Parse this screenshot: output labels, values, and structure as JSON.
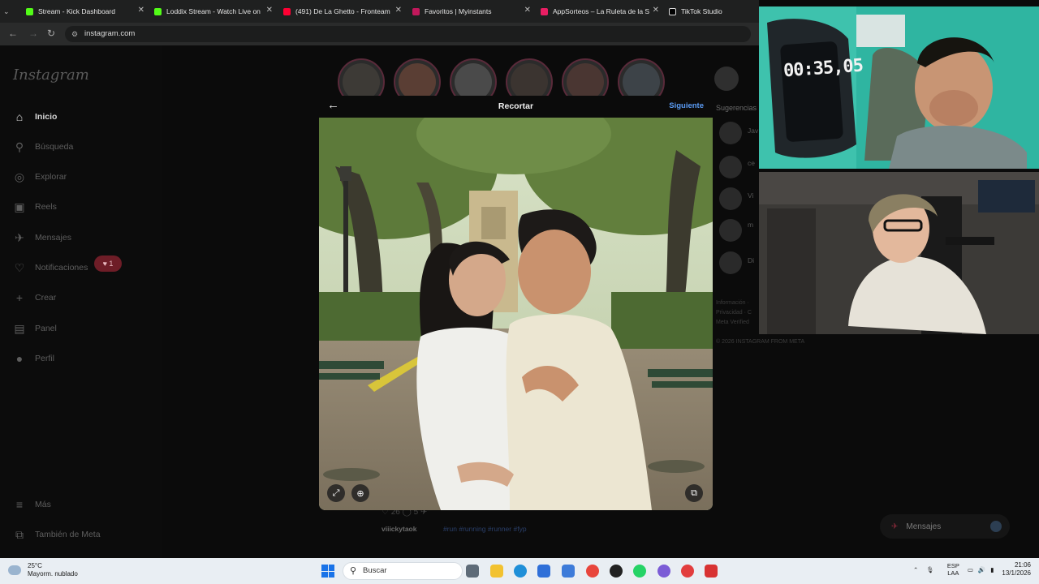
{
  "browser": {
    "tabs": [
      {
        "label": "Stream - Kick Dashboard",
        "color": "#53fc18"
      },
      {
        "label": "Loddix Stream - Watch Live on",
        "color": "#53fc18"
      },
      {
        "label": "(491) De La Ghetto - Fronteam",
        "color": "#ff0033"
      },
      {
        "label": "Favoritos | Myinstants",
        "color": "#c2185b"
      },
      {
        "label": "AppSorteos – La Ruleta de la S",
        "color": "#e91e63"
      },
      {
        "label": "TikTok Studio",
        "color": "#111111"
      }
    ],
    "url": "instagram.com"
  },
  "instagram": {
    "logo": "Instagram",
    "nav": [
      {
        "label": "Inicio",
        "icon": "home-icon",
        "glyph": "⌂",
        "active": true
      },
      {
        "label": "Búsqueda",
        "icon": "search-icon",
        "glyph": "⚲"
      },
      {
        "label": "Explorar",
        "icon": "compass-icon",
        "glyph": "◎"
      },
      {
        "label": "Reels",
        "icon": "reels-icon",
        "glyph": "▣"
      },
      {
        "label": "Mensajes",
        "icon": "messenger-icon",
        "glyph": "✈"
      },
      {
        "label": "Notificaciones",
        "icon": "heart-icon",
        "glyph": "♡"
      },
      {
        "label": "Crear",
        "icon": "plus-icon",
        "glyph": "+"
      },
      {
        "label": "Panel",
        "icon": "panel-icon",
        "glyph": "▤"
      },
      {
        "label": "Perfil",
        "icon": "profile-icon",
        "glyph": "●"
      }
    ],
    "notif_badge": "♥ 1",
    "more": "Más",
    "meta": "También de Meta",
    "suggestions_title": "Sugerencias",
    "suggestions": [
      "Jav",
      "ce",
      "Vi",
      "m",
      "Di"
    ],
    "footer": [
      "Información ·",
      "Privacidad · C",
      "Meta Verified"
    ],
    "copyright": "© 2026 INSTAGRAM FROM META",
    "post_user": "viiickytaok",
    "post_tags": "#run #running #runner #fyp",
    "post_likes": "♡ 26   ◯ 5   ✈",
    "messages_pill": "Mensajes"
  },
  "crop_modal": {
    "back": "←",
    "title": "Recortar",
    "next": "Siguiente",
    "expand_icon": "⤢",
    "zoom_icon": "⊕",
    "gallery_icon": "⧉"
  },
  "stream": {
    "timer": "00:35,05"
  },
  "taskbar": {
    "temp": "25°C",
    "weather": "Mayorm. nublado",
    "search": "Buscar",
    "lang_top": "ESP",
    "lang_bottom": "LAA",
    "time": "21:06",
    "date": "13/1/2026"
  }
}
